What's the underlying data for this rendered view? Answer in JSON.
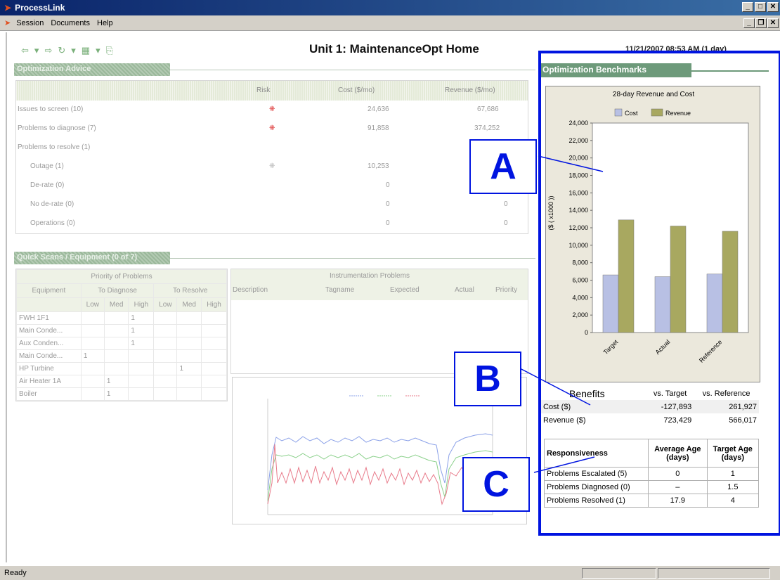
{
  "window": {
    "title": "ProcessLink",
    "min_btn": "_",
    "max_btn": "□",
    "close_btn": "✕",
    "mdi_min": "_",
    "mdi_restore": "❐",
    "mdi_close": "✕"
  },
  "menu": [
    "Session",
    "Documents",
    "Help"
  ],
  "page": {
    "title": "Unit 1: MaintenanceOpt Home",
    "date": "11/21/2007 08:53 AM (1 day)"
  },
  "toolbar": [
    "⇦",
    "▾",
    "⇨",
    "↻",
    "▾",
    "▦",
    "▾",
    "⎘"
  ],
  "advice": {
    "section_title": "Optimization Advice",
    "headers": {
      "risk": "Risk",
      "cost": "Cost ($/mo)",
      "revenue": "Revenue ($/mo)"
    },
    "rows": [
      {
        "label": "Issues to screen (10)",
        "risk": "red",
        "cost": "24,636",
        "revenue": "67,686"
      },
      {
        "label": "Problems to diagnose (7)",
        "risk": "red",
        "cost": "91,858",
        "revenue": "374,252"
      },
      {
        "label": "Problems to resolve (1)",
        "risk": "",
        "cost": "",
        "revenue": ""
      },
      {
        "label": "Outage (1)",
        "risk": "grey",
        "cost": "10,253",
        "revenue": ""
      },
      {
        "label": "De-rate (0)",
        "risk": "",
        "cost": "0",
        "revenue": ""
      },
      {
        "label": "No de-rate (0)",
        "risk": "",
        "cost": "0",
        "revenue": "0"
      },
      {
        "label": "Operations (0)",
        "risk": "",
        "cost": "0",
        "revenue": "0"
      }
    ]
  },
  "quick": {
    "section_title": "Quick Scans / Equipment (0 of 7)",
    "priority_title": "Priority of Problems",
    "equipment_head": "Equipment",
    "to_diagnose": "To Diagnose",
    "to_resolve": "To Resolve",
    "levels": [
      "Low",
      "Med",
      "High",
      "Low",
      "Med",
      "High"
    ],
    "rows": [
      {
        "name": "FWH 1F1",
        "vals": [
          "",
          "",
          "1",
          "",
          "",
          ""
        ]
      },
      {
        "name": "Main Conde...",
        "vals": [
          "",
          "",
          "1",
          "",
          "",
          ""
        ]
      },
      {
        "name": "Aux Conden...",
        "vals": [
          "",
          "",
          "1",
          "",
          "",
          ""
        ]
      },
      {
        "name": "Main Conde...",
        "vals": [
          "1",
          "",
          "",
          "",
          "",
          ""
        ]
      },
      {
        "name": "HP Turbine",
        "vals": [
          "",
          "",
          "",
          "",
          "1",
          ""
        ]
      },
      {
        "name": "Air Heater 1A",
        "vals": [
          "",
          "1",
          "",
          "",
          "",
          ""
        ]
      },
      {
        "name": "Boiler",
        "vals": [
          "",
          "1",
          "",
          "",
          "",
          ""
        ]
      }
    ]
  },
  "instrumentation": {
    "title": "Instrumentation Problems",
    "columns": [
      "Description",
      "Tagname",
      "Expected",
      "Actual",
      "Priority"
    ]
  },
  "benchmarks": {
    "section_title": "Optimization Benchmarks",
    "chart_data": {
      "type": "bar",
      "title": "28-day Revenue and Cost",
      "ylabel": "($ ( x1000 ))",
      "categories": [
        "Target",
        "Actual",
        "Reference"
      ],
      "series": [
        {
          "name": "Cost",
          "values": [
            6600,
            6400,
            6700
          ],
          "color": "#b8c0e4"
        },
        {
          "name": "Revenue",
          "values": [
            12900,
            12200,
            11600
          ],
          "color": "#a8a860"
        }
      ],
      "ylim": [
        0,
        24000
      ],
      "yticks": [
        "0",
        "2,000",
        "4,000",
        "6,000",
        "8,000",
        "10,000",
        "12,000",
        "14,000",
        "16,000",
        "18,000",
        "20,000",
        "22,000",
        "24,000"
      ],
      "legend": "top"
    },
    "benefits": {
      "head": "Benefits",
      "col1": "vs. Target",
      "col2": "vs. Reference",
      "rows": [
        {
          "label": "Cost ($)",
          "v1": "-127,893",
          "v2": "261,927"
        },
        {
          "label": "Revenue ($)",
          "v1": "723,429",
          "v2": "566,017"
        }
      ]
    },
    "responsiveness": {
      "head": "Responsiveness",
      "col1": "Average Age (days)",
      "col2": "Target Age (days)",
      "rows": [
        {
          "label": "Problems Escalated (5)",
          "v1": "0",
          "v2": "1"
        },
        {
          "label": "Problems Diagnosed (0)",
          "v1": "–",
          "v2": "1.5"
        },
        {
          "label": "Problems Resolved (1)",
          "v1": "17.9",
          "v2": "4"
        }
      ]
    }
  },
  "callouts": [
    "A",
    "B",
    "C"
  ],
  "status": {
    "text": "Ready"
  },
  "colors": {
    "accent": "#0014e0",
    "header_green": "#6d9a7a"
  }
}
